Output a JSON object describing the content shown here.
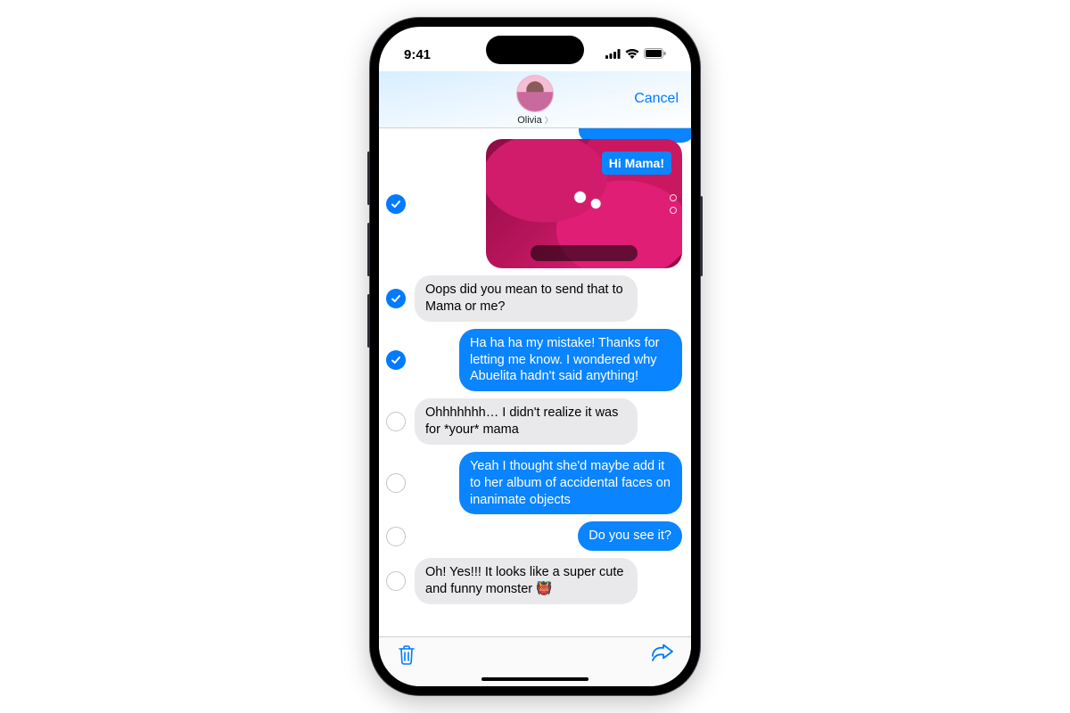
{
  "status": {
    "time": "9:41"
  },
  "header": {
    "contact_name": "Olivia",
    "cancel_label": "Cancel"
  },
  "image_message": {
    "caption": "Hi Mama!",
    "selected": true
  },
  "messages": [
    {
      "side": "incoming",
      "selected": true,
      "text": "Oops did you mean to send that to Mama or me?"
    },
    {
      "side": "outgoing",
      "selected": true,
      "text": "Ha ha ha my mistake! Thanks for letting me know. I wondered why Abuelita hadn't said anything!"
    },
    {
      "side": "incoming",
      "selected": false,
      "text": "Ohhhhhhh… I didn't realize it was for *your* mama"
    },
    {
      "side": "outgoing",
      "selected": false,
      "text": "Yeah I thought she'd maybe add it to her album of accidental faces on inanimate objects"
    },
    {
      "side": "outgoing",
      "selected": false,
      "text": "Do you see it?"
    },
    {
      "side": "incoming",
      "selected": false,
      "text": "Oh! Yes!!! It looks like a super cute and funny monster 👹"
    }
  ],
  "toolbar": {
    "trash_label": "Delete",
    "share_label": "Share"
  }
}
